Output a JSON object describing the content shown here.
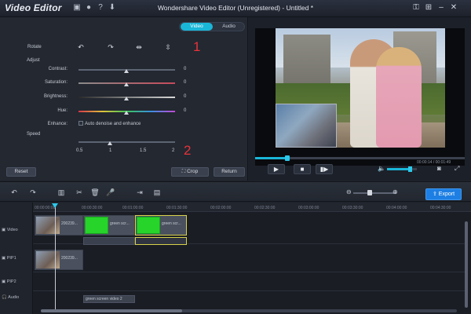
{
  "app": {
    "name": "Video Editor",
    "window_title": "Wondershare Video Editor (Unregistered) - Untitled *"
  },
  "titlebar_icons": [
    "save-icon",
    "chat-icon",
    "help-icon",
    "download-icon"
  ],
  "titlebar_right_icons": [
    "key-icon",
    "cart-icon",
    "minimize-icon",
    "close-icon"
  ],
  "edit_panel": {
    "tabs": [
      {
        "label": "Video",
        "active": true
      },
      {
        "label": "Audio",
        "active": false
      }
    ],
    "rotate_label": "Rotate",
    "rotate_icons": [
      "rotate-left-icon",
      "rotate-right-icon",
      "flip-horizontal-icon",
      "flip-vertical-icon"
    ],
    "adjust_label": "Adjust",
    "adjust": [
      {
        "label": "Contrast:",
        "value": "0",
        "position": 0.5
      },
      {
        "label": "Saturation:",
        "value": "0",
        "position": 0.5
      },
      {
        "label": "Brightness:",
        "value": "0",
        "position": 0.5
      },
      {
        "label": "Hue:",
        "value": "0",
        "position": 0.5
      }
    ],
    "enhance_label": "Enhance:",
    "enhance_option": "Auto denoise and enhance",
    "speed_label": "Speed",
    "speed_ticks": [
      "0.5",
      "1",
      "1.5",
      "2"
    ],
    "speed_value": 1,
    "annotation_1": "1",
    "annotation_2": "2",
    "reset_button": "Reset",
    "crop_button": "Crop",
    "return_button": "Return"
  },
  "preview": {
    "timecode": "00:00:14 / 00:01:49",
    "progress": 0.15,
    "volume": 0.8
  },
  "toolbar": {
    "icons": [
      "undo-icon",
      "redo-icon",
      "clip-icon",
      "cut-icon",
      "delete-icon",
      "mic-icon",
      "split-icon",
      "detach-icon"
    ],
    "export_button": "Export"
  },
  "timeline": {
    "ruler_ticks": [
      "00:00:00:00",
      "00:00:30:00",
      "00:01:00:00",
      "00:01:30:00",
      "00:02:00:00",
      "00:02:30:00",
      "00:03:00:00",
      "00:03:30:00",
      "00:04:00:00",
      "00:04:30:00"
    ],
    "tracks": [
      {
        "label": "Video"
      },
      {
        "label": "PIP1"
      },
      {
        "label": "PIP2"
      },
      {
        "label": "Audio"
      }
    ],
    "video_clips": [
      {
        "name": "200239..."
      },
      {
        "name": "green scr..."
      },
      {
        "name": "green scr..."
      }
    ],
    "pip_clips": [
      {
        "name": "200239..."
      }
    ],
    "audio_clips": [
      {
        "name": "green screen video 2"
      }
    ]
  }
}
